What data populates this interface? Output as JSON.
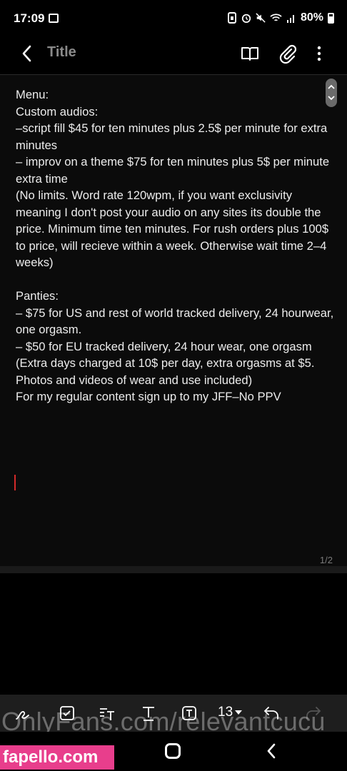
{
  "status": {
    "time": "17:09",
    "battery": "80%"
  },
  "appbar": {
    "title": "Title"
  },
  "note": {
    "text": "Menu:\nCustom audios:\n–script fill $45 for ten minutes plus 2.5$ per minute for extra minutes\n– improv on a theme $75 for ten minutes plus 5$ per minute extra time\n(No limits. Word rate 120wpm, if you want exclusivity meaning I don't post your audio on any sites its double the price. Minimum time ten minutes. For rush orders plus 100$ to price, will recieve within a week. Otherwise wait time 2–4 weeks)\n\nPanties:\n– $75 for US and rest of world tracked delivery, 24 hourwear, one orgasm.\n– $50 for EU tracked delivery, 24 hour wear, one orgasm\n(Extra days charged at 10$ per day, extra orgasms at $5. Photos and videos of wear and use included)\nFor my regular content sign up to my JFF–No PPV",
    "page_indicator": "1/2"
  },
  "toolbar": {
    "font_size": "13"
  },
  "watermark": "OnlyFans.com/relevantcucu",
  "badge": "fapello.com",
  "colors": {
    "cursor": "#d42a2a",
    "badge": "#e83e8c"
  },
  "icons": [
    "image-icon",
    "alarm-icon",
    "mute-icon",
    "wifi-icon",
    "signal-icon",
    "battery-icon",
    "back-arrow-icon",
    "book-icon",
    "paperclip-icon",
    "more-icon",
    "pen-icon",
    "checkbox-icon",
    "text-style-icon",
    "text-icon",
    "text-box-icon",
    "undo-icon",
    "redo-icon",
    "home-icon",
    "nav-back-icon"
  ]
}
